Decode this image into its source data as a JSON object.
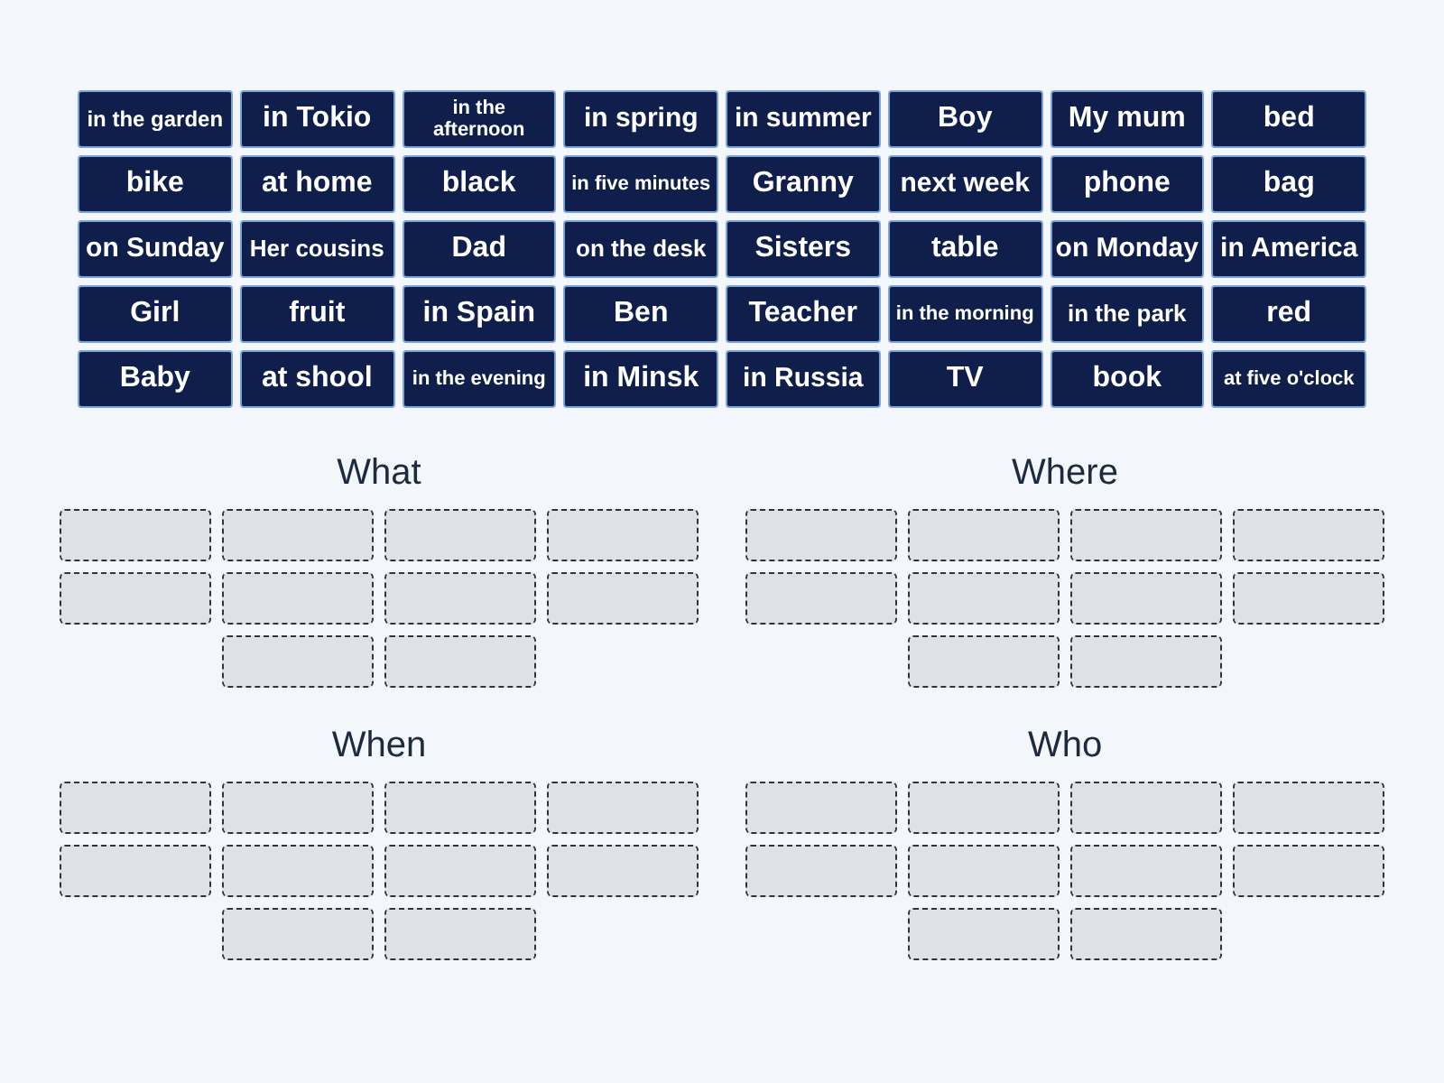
{
  "tiles": [
    "in the garden",
    "in Tokio",
    "in the afternoon",
    "in spring",
    "in summer",
    "Boy",
    "My mum",
    "bed",
    "bike",
    "at home",
    "black",
    "in five minutes",
    "Granny",
    "next week",
    "phone",
    "bag",
    "on Sunday",
    "Her cousins",
    "Dad",
    "on the desk",
    "Sisters",
    "table",
    "on Monday",
    "in America",
    "Girl",
    "fruit",
    "in Spain",
    "Ben",
    "Teacher",
    "in the morning",
    "in the park",
    "red",
    "Baby",
    "at shool",
    "in the evening",
    "in Minsk",
    "in Russia",
    "TV",
    "book",
    "at five o'clock"
  ],
  "groups": [
    {
      "title": "What"
    },
    {
      "title": "Where"
    },
    {
      "title": "When"
    },
    {
      "title": "Who"
    }
  ]
}
